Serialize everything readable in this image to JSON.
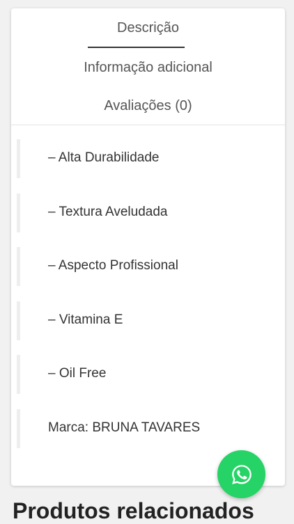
{
  "tabs": [
    {
      "label": "Descrição",
      "active": true
    },
    {
      "label": "Informação adicional",
      "active": false
    },
    {
      "label": "Avaliações (0)",
      "active": false
    }
  ],
  "description": {
    "items": [
      "– Alta Durabilidade",
      "– Textura Aveludada",
      "– Aspecto Profissional",
      "– Vitamina E",
      "– Oil Free",
      "Marca: BRUNA TAVARES"
    ]
  },
  "whatsapp": {
    "icon": "whatsapp-icon",
    "color": "#25d366"
  },
  "related": {
    "heading": "Produtos relacionados"
  }
}
